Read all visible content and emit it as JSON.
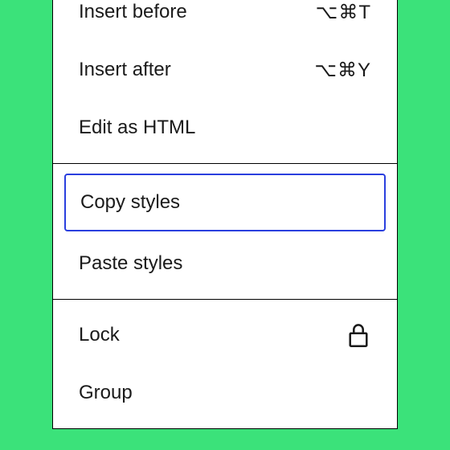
{
  "menu": {
    "sections": [
      {
        "items": [
          {
            "label": "Insert before",
            "shortcut": "⌥⌘T"
          },
          {
            "label": "Insert after",
            "shortcut": "⌥⌘Y"
          },
          {
            "label": "Edit as HTML"
          }
        ]
      },
      {
        "items": [
          {
            "label": "Copy styles",
            "selected": true
          },
          {
            "label": "Paste styles"
          }
        ]
      },
      {
        "items": [
          {
            "label": "Lock",
            "icon": "lock-icon"
          },
          {
            "label": "Group"
          }
        ]
      }
    ]
  }
}
